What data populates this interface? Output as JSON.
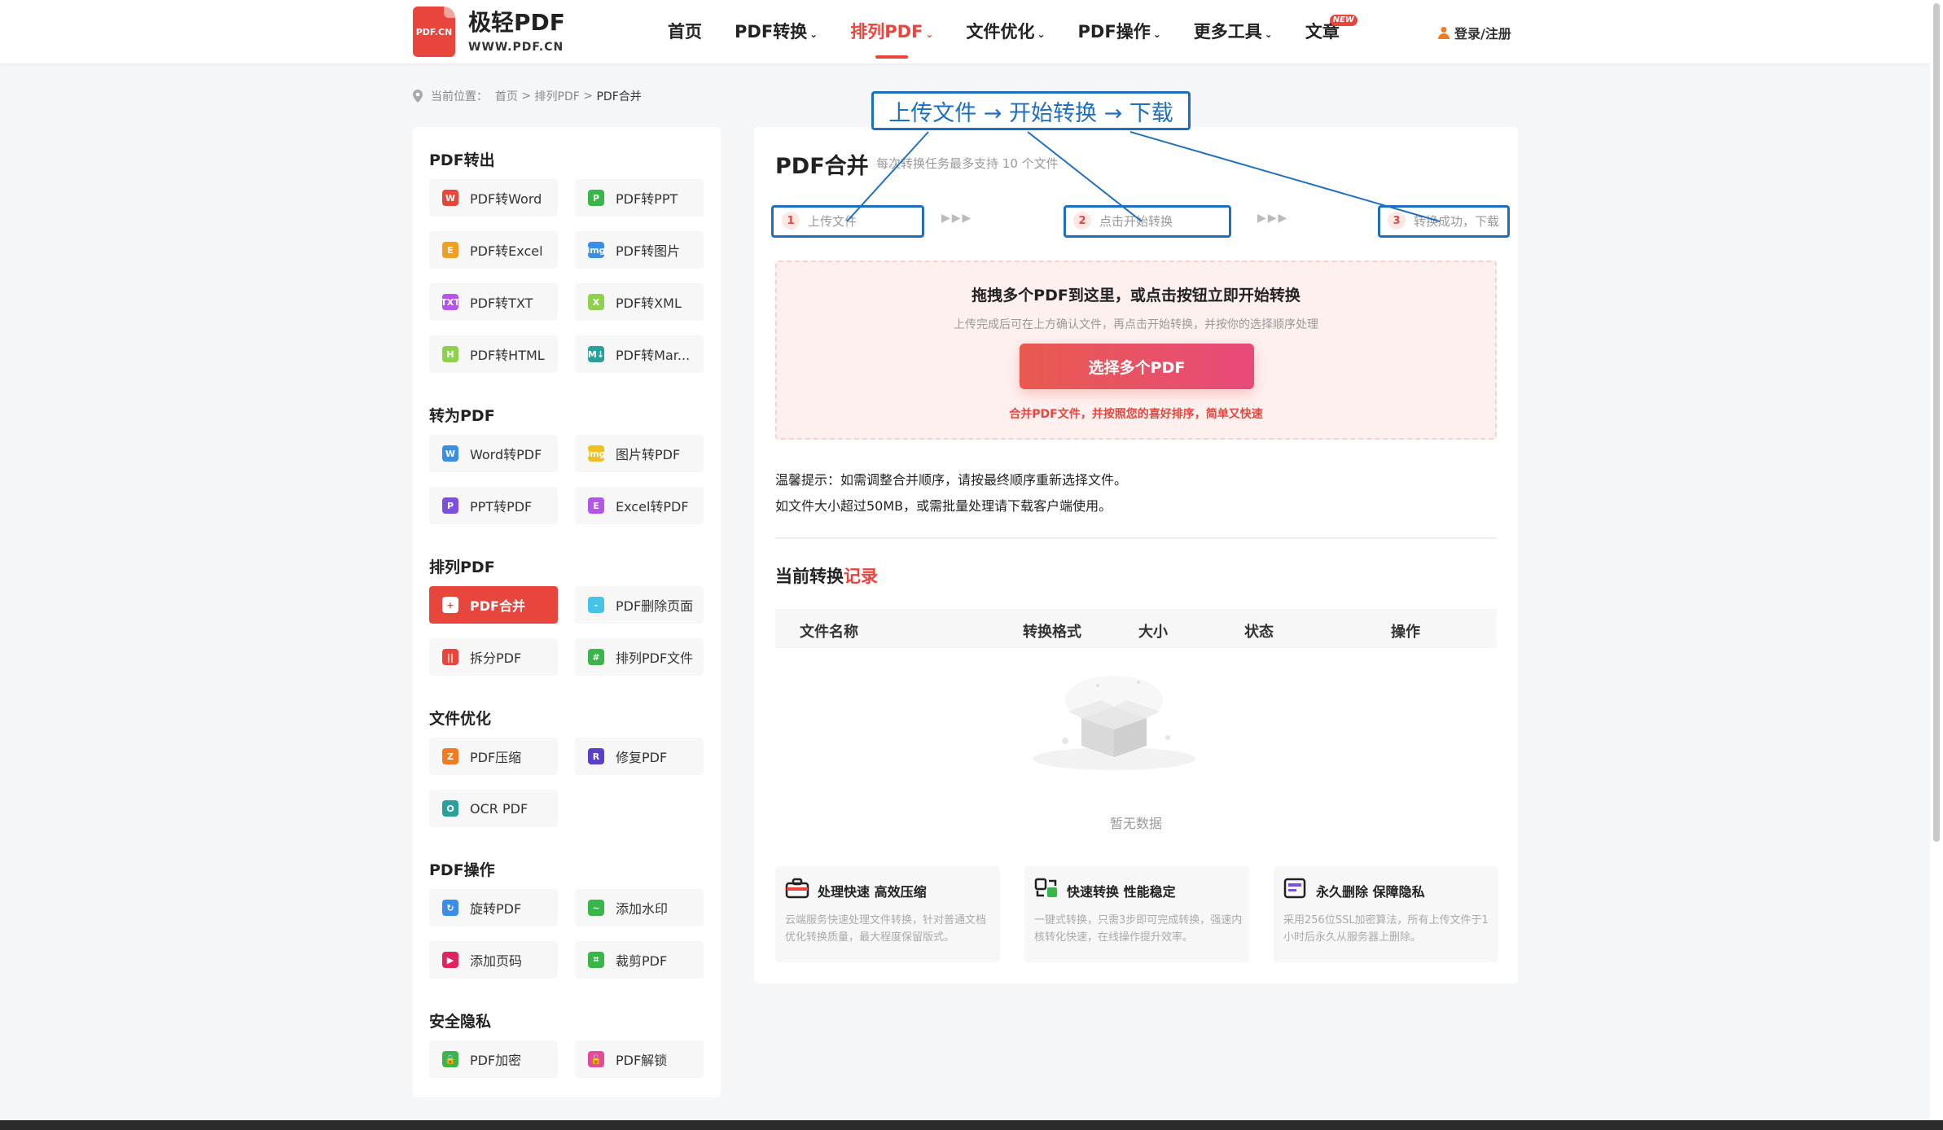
{
  "header": {
    "logo_mark": "PDF.CN",
    "logo_name": "极轻PDF",
    "logo_url": "WWW.PDF.CN",
    "nav": [
      {
        "label": "首页",
        "caret": false,
        "active": false
      },
      {
        "label": "PDF转换",
        "caret": true,
        "active": false
      },
      {
        "label": "排列PDF",
        "caret": true,
        "active": true
      },
      {
        "label": "文件优化",
        "caret": true,
        "active": false
      },
      {
        "label": "PDF操作",
        "caret": true,
        "active": false
      },
      {
        "label": "更多工具",
        "caret": true,
        "active": false
      },
      {
        "label": "文章",
        "caret": false,
        "active": false,
        "badge": "NEW"
      }
    ],
    "login": "登录/注册"
  },
  "breadcrumb": {
    "prefix": "当前位置：",
    "home": "首页",
    "sep": ">",
    "section": "排列PDF",
    "current": "PDF合并"
  },
  "sidebar": {
    "groups": [
      {
        "title": "PDF转出",
        "tools": [
          {
            "label": "PDF转Word",
            "icon": "W",
            "color": "#e8453c"
          },
          {
            "label": "PDF转PPT",
            "icon": "P",
            "color": "#39b54a"
          },
          {
            "label": "PDF转Excel",
            "icon": "E",
            "color": "#f0a020"
          },
          {
            "label": "PDF转图片",
            "icon": "img",
            "color": "#3a8ee6"
          },
          {
            "label": "PDF转TXT",
            "icon": "TXT",
            "color": "#b455e8"
          },
          {
            "label": "PDF转XML",
            "icon": "X",
            "color": "#8fd14f"
          },
          {
            "label": "PDF转HTML",
            "icon": "H",
            "color": "#8fd14f"
          },
          {
            "label": "PDF转Mar...",
            "icon": "M↓",
            "color": "#2aa198"
          }
        ]
      },
      {
        "title": "转为PDF",
        "tools": [
          {
            "label": "Word转PDF",
            "icon": "W",
            "color": "#3a8ee6"
          },
          {
            "label": "图片转PDF",
            "icon": "img",
            "color": "#f0c020"
          },
          {
            "label": "PPT转PDF",
            "icon": "P",
            "color": "#7b4fe0"
          },
          {
            "label": "Excel转PDF",
            "icon": "E",
            "color": "#b455e8"
          }
        ]
      },
      {
        "title": "排列PDF",
        "tools": [
          {
            "label": "PDF合并",
            "icon": "+",
            "color": "#e8453c",
            "active": true
          },
          {
            "label": "PDF删除页面",
            "icon": "-",
            "color": "#45c4e8"
          },
          {
            "label": "拆分PDF",
            "icon": "||",
            "color": "#e8453c"
          },
          {
            "label": "排列PDF文件",
            "icon": "#",
            "color": "#39b54a"
          }
        ]
      },
      {
        "title": "文件优化",
        "tools": [
          {
            "label": "PDF压缩",
            "icon": "Z",
            "color": "#f07b20"
          },
          {
            "label": "修复PDF",
            "icon": "R",
            "color": "#5b3fc8"
          },
          {
            "label": "OCR PDF",
            "icon": "O",
            "color": "#2aa198"
          }
        ]
      },
      {
        "title": "PDF操作",
        "tools": [
          {
            "label": "旋转PDF",
            "icon": "↻",
            "color": "#3a8ee6"
          },
          {
            "label": "添加水印",
            "icon": "~",
            "color": "#39b54a"
          },
          {
            "label": "添加页码",
            "icon": "▶",
            "color": "#e0245e"
          },
          {
            "label": "裁剪PDF",
            "icon": "⌗",
            "color": "#39b54a"
          }
        ]
      },
      {
        "title": "安全隐私",
        "tools": [
          {
            "label": "PDF加密",
            "icon": "🔒",
            "color": "#39b54a"
          },
          {
            "label": "PDF解锁",
            "icon": "🔓",
            "color": "#e84a9a"
          }
        ]
      }
    ]
  },
  "main": {
    "title": "PDF合并",
    "subtitle": "每次转换任务最多支持 10 个文件",
    "steps": [
      {
        "num": "1",
        "label": "上传文件"
      },
      {
        "num": "2",
        "label": "点击开始转换"
      },
      {
        "num": "3",
        "label": "转换成功，下载"
      }
    ],
    "step_arrows": "▶▶▶",
    "dropzone": {
      "title": "拖拽多个PDF到这里，或点击按钮立即开始转换",
      "tip": "上传完成后可在上方确认文件，再点击开始转换，并按你的选择顺序处理",
      "button": "选择多个PDF",
      "note": "合并PDF文件，并按照您的喜好排序，简单又快速"
    },
    "notice_1": "温馨提示：如需调整合并顺序，请按最终顺序重新选择文件。",
    "notice_2": "如文件大小超过50MB，或需批量处理请下载客户端使用。",
    "records": {
      "title_a": "当前转换",
      "title_b": "记录",
      "columns": [
        "文件名称",
        "转换格式",
        "大小",
        "状态",
        "操作"
      ],
      "empty": "暂无数据"
    },
    "features": [
      {
        "title": "处理快速 高效压缩",
        "desc": "云端服务快速处理文件转换，针对普通文档优化转换质量，最大程度保留版式。",
        "icon": "toolbox-icon"
      },
      {
        "title": "快速转换 性能稳定",
        "desc": "一键式转换，只需3步即可完成转换，强速内核转化快速，在线操作提升效率。",
        "icon": "swap-icon"
      },
      {
        "title": "永久删除 保障隐私",
        "desc": "采用256位SSL加密算法，所有上传文件于1小时后永久从服务器上删除。",
        "icon": "shield-doc-icon"
      }
    ]
  },
  "annotation": {
    "label": "上传文件 → 开始转换 → 下载",
    "color": "#1f6fbf"
  }
}
